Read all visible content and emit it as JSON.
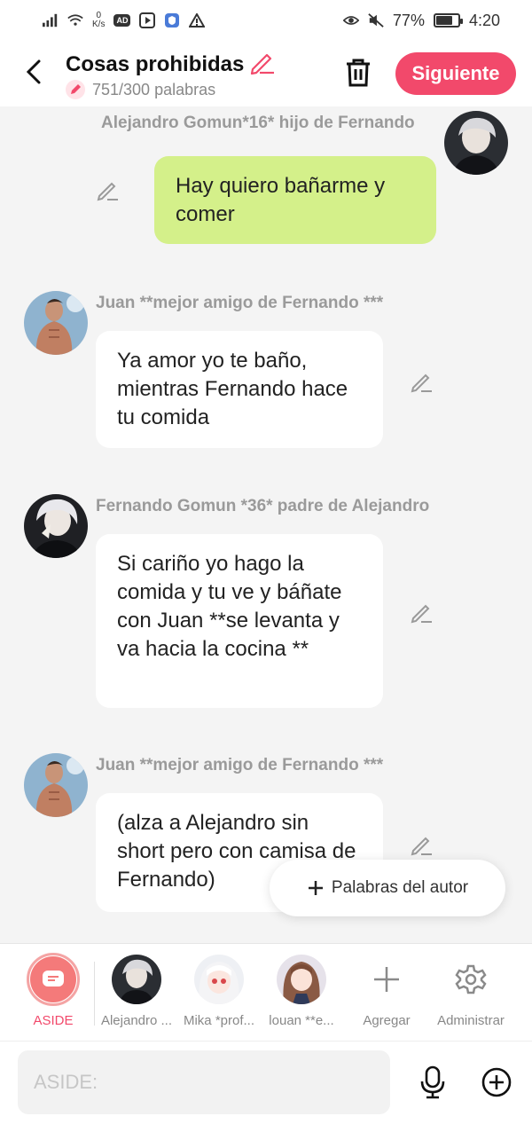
{
  "status_bar": {
    "speed_value": "0",
    "speed_unit": "K/s",
    "ad_label": "AD",
    "battery": "77%",
    "battery_level": 0.77,
    "time": "4:20"
  },
  "header": {
    "title": "Cosas prohibidas",
    "word_count": "751/300 palabras",
    "next_label": "Siguiente",
    "accent_color": "#f2496b"
  },
  "messages": [
    {
      "side": "right",
      "sender": "Alejandro Gomun*16* hijo de Fernando",
      "text": "Hay quiero bañarme y comer"
    },
    {
      "side": "left",
      "sender": "Juan **mejor amigo de Fernando ***",
      "text": "Ya amor yo te baño, mientras Fernando hace tu comida"
    },
    {
      "side": "left",
      "sender": "Fernando Gomun  *36* padre de Alejandro",
      "text": "Si cariño yo hago la comida y tu ve y báñate con Juan **se levanta y va hacia la cocina **"
    },
    {
      "side": "left",
      "sender": "Juan **mejor amigo de Fernando ***",
      "text": "(alza a Alejandro sin short pero con camisa de Fernando)"
    }
  ],
  "fab": {
    "label": "Palabras del autor"
  },
  "characters": [
    {
      "label": "ASIDE"
    },
    {
      "label": "Alejandro ..."
    },
    {
      "label": "Mika *prof..."
    },
    {
      "label": "louan **e..."
    },
    {
      "label": "Agregar"
    },
    {
      "label": "Administrar"
    }
  ],
  "input": {
    "placeholder": "ASIDE:"
  }
}
